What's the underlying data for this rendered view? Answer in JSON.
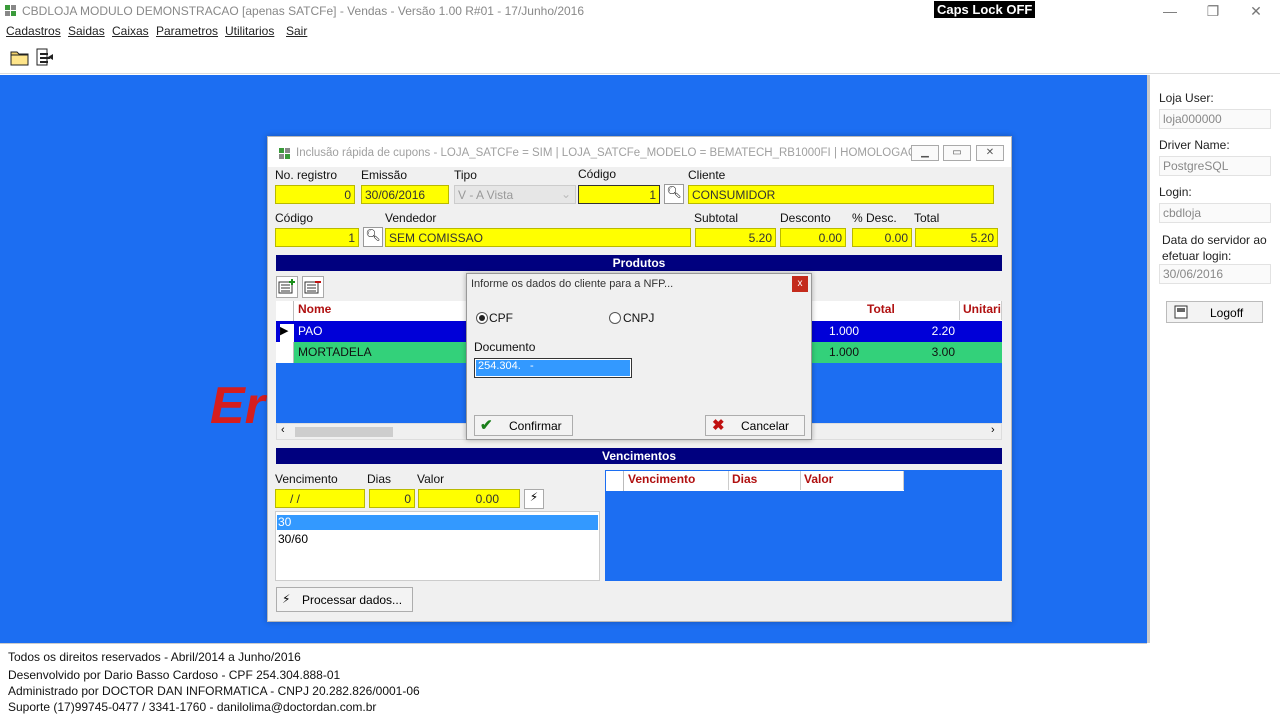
{
  "window": {
    "title": "CBDLOJA MODULO DEMONSTRACAO [apenas SATCFe] - Vendas - Versão 1.00 R#01 - 17/Junho/2016",
    "caps_lock": "Caps Lock OFF",
    "minimize": "—",
    "restore": "❐",
    "close": "✕"
  },
  "menu": [
    "Cadastros",
    "Saidas",
    "Caixas",
    "Parametros",
    "Utilitarios",
    "Sair"
  ],
  "background_letters": "Er",
  "right_panel": {
    "loja_user_label": "Loja User:",
    "loja_user_value": "loja000000",
    "driver_label": "Driver Name:",
    "driver_value": "PostgreSQL",
    "login_label": "Login:",
    "login_value": "cbdloja",
    "server_date_label": "Data do servidor ao efetuar login:",
    "server_date_value": "30/06/2016",
    "logoff_label": "Logoff"
  },
  "footer": [
    "Todos os direitos reservados - Abril/2014 a Junho/2016",
    "Desenvolvido por Dario Basso Cardoso - CPF 254.304.888-01",
    "Administrado por DOCTOR DAN INFORMATICA - CNPJ 20.282.826/0001-06",
    "Suporte (17)99745-0477 / 3341-1760 - danilolima@doctordan.com.br"
  ],
  "dialog": {
    "title": "Inclusão rápida de cupons - LOJA_SATCFe = SIM | LOJA_SATCFe_MODELO = BEMATECH_RB1000FI | HOMOLOGAÇÃO",
    "header": {
      "no_registro_label": "No. registro",
      "no_registro_value": "0",
      "emissao_label": "Emissão",
      "emissao_value": "30/06/2016",
      "tipo_label": "Tipo",
      "tipo_value": "V - A Vista",
      "codigo_label": "Código",
      "codigo_value": "1",
      "cliente_label": "Cliente",
      "cliente_value": "CONSUMIDOR"
    },
    "vendor": {
      "codigo_label": "Código",
      "codigo_value": "1",
      "vendedor_label": "Vendedor",
      "vendedor_value": "SEM COMISSAO",
      "subtotal_label": "Subtotal",
      "subtotal_value": "5.20",
      "desconto_label": "Desconto",
      "desconto_value": "0.00",
      "pdesc_label": "% Desc.",
      "pdesc_value": "0.00",
      "total_label": "Total",
      "total_value": "5.20"
    },
    "produtos_title": "Produtos",
    "produtos_columns": {
      "nome": "Nome",
      "total": "Total",
      "unitario": "Unitari"
    },
    "produtos": [
      {
        "nome": "PAO",
        "qtd": "1.000",
        "total": "2.20"
      },
      {
        "nome": "MORTADELA",
        "qtd": "1.000",
        "total": "3.00"
      }
    ],
    "vencimentos_title": "Vencimentos",
    "venc_form": {
      "vencimento_label": "Vencimento",
      "vencimento_value": "/  /",
      "dias_label": "Dias",
      "dias_value": "0",
      "valor_label": "Valor",
      "valor_value": "0.00"
    },
    "prazos": [
      "30",
      "30/60"
    ],
    "venc_columns": [
      "Vencimento",
      "Dias",
      "Valor"
    ],
    "processar_label": "Processar dados..."
  },
  "nfp": {
    "title": "Informe os dados do cliente para a NFP...",
    "close": "x",
    "cpf_label": "CPF",
    "cnpj_label": "CNPJ",
    "documento_label": "Documento",
    "documento_value": "254.304.   -",
    "confirmar_label": "Confirmar",
    "cancelar_label": "Cancelar"
  }
}
